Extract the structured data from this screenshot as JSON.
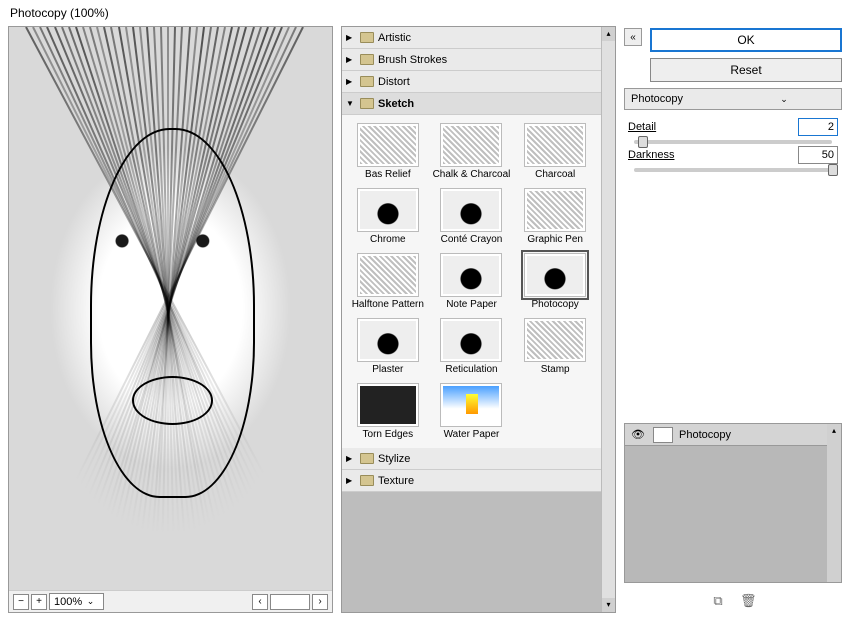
{
  "title": "Photocopy (100%)",
  "preview": {
    "zoom": "100%"
  },
  "categories": [
    {
      "label": "Artistic",
      "expanded": false
    },
    {
      "label": "Brush Strokes",
      "expanded": false
    },
    {
      "label": "Distort",
      "expanded": false
    },
    {
      "label": "Sketch",
      "expanded": true
    },
    {
      "label": "Stylize",
      "expanded": false
    },
    {
      "label": "Texture",
      "expanded": false
    }
  ],
  "sketch_filters": [
    "Bas Relief",
    "Chalk & Charcoal",
    "Charcoal",
    "Chrome",
    "Conté Crayon",
    "Graphic Pen",
    "Halftone Pattern",
    "Note Paper",
    "Photocopy",
    "Plaster",
    "Reticulation",
    "Stamp",
    "Torn Edges",
    "Water Paper"
  ],
  "selected_filter_index": 8,
  "buttons": {
    "ok": "OK",
    "reset": "Reset"
  },
  "filter_dropdown": "Photocopy",
  "params": [
    {
      "name": "Detail",
      "value": "2",
      "pos": 2
    },
    {
      "name": "Darkness",
      "value": "50",
      "pos": 98
    }
  ],
  "layers": [
    {
      "name": "Photocopy",
      "visible": true
    }
  ],
  "icons": {
    "new_layer": "⧉",
    "trash": "🗑"
  }
}
